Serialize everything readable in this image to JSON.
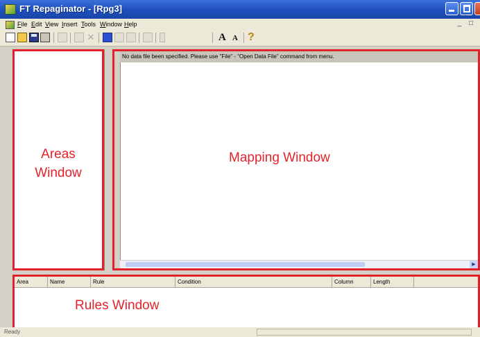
{
  "window": {
    "title": "FT Repaginator - [Rpg3]"
  },
  "menu": {
    "items": [
      "File",
      "Edit",
      "View",
      "Insert",
      "Tools",
      "Window",
      "Help"
    ],
    "mdi_controls": "_ □"
  },
  "toolbar": {
    "icons": [
      "new-file-icon",
      "open-folder-icon",
      "save-icon",
      "print-icon",
      "check-icon",
      "edit-icon",
      "delete-icon",
      "area-top-icon",
      "area-bottom-icon",
      "area-both-icon",
      "area-split-icon",
      "cursor-icon",
      "font-larger-icon",
      "font-smaller-icon",
      "help-icon"
    ],
    "font_big": "A",
    "font_small": "A",
    "help": "?"
  },
  "panes": {
    "areas_label": "Areas Window",
    "mapping_label": "Mapping Window",
    "mapping_status": "No data file been specified. Please use \"File\" - \"Open Data File\" command from menu.",
    "rules_label": "Rules Window"
  },
  "rules_columns": [
    "Area",
    "Name",
    "Rule",
    "Condition",
    "Column",
    "Length"
  ],
  "statusbar": {
    "text": "Ready"
  },
  "colors": {
    "highlight_border": "#e2222b",
    "titlebar": "#1f4fbf"
  }
}
